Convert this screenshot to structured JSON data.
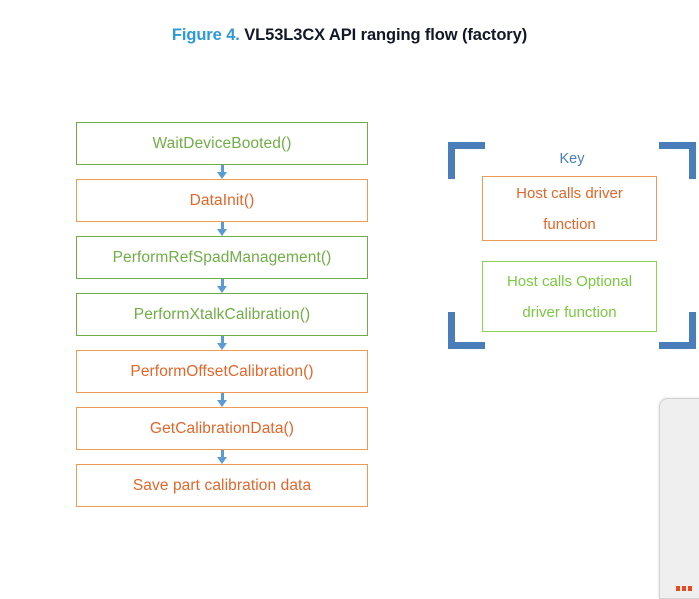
{
  "caption": {
    "figure_number": "Figure 4.",
    "title": "VL53L3CX API ranging flow (factory)"
  },
  "colors": {
    "caption_accent": "#2d9ad6",
    "caption_text": "#111827",
    "green_border": "#70ad47",
    "green_text": "#70ad47",
    "key_green_border": "#8fd14f",
    "key_green_text": "#7ac943",
    "orange_border": "#ed9b52",
    "orange_text": "#e2662a",
    "arrow": "#5b9bd5",
    "bracket": "#4a7ebb",
    "key_title": "#4a7ebb",
    "panel_bg": "#efefef",
    "panel_dot": "#e8491d"
  },
  "flow": {
    "nodes": [
      {
        "label": "WaitDeviceBooted()",
        "style": "green"
      },
      {
        "label": "DataInit()",
        "style": "orange"
      },
      {
        "label": "PerformRefSpadManagement()",
        "style": "green"
      },
      {
        "label": "PerformXtalkCalibration()",
        "style": "green"
      },
      {
        "label": "PerformOffsetCalibration()",
        "style": "orange"
      },
      {
        "label": "GetCalibrationData()",
        "style": "orange"
      },
      {
        "label": "Save part calibration data",
        "style": "orange"
      }
    ]
  },
  "key": {
    "title": "Key",
    "entries": [
      {
        "line1": "Host calls driver",
        "line2": "function",
        "style": "orange"
      },
      {
        "line1": "Host calls Optional",
        "line2": "driver function",
        "style": "green"
      }
    ]
  },
  "side_panel": {
    "dots": [
      "",
      "",
      ""
    ]
  }
}
